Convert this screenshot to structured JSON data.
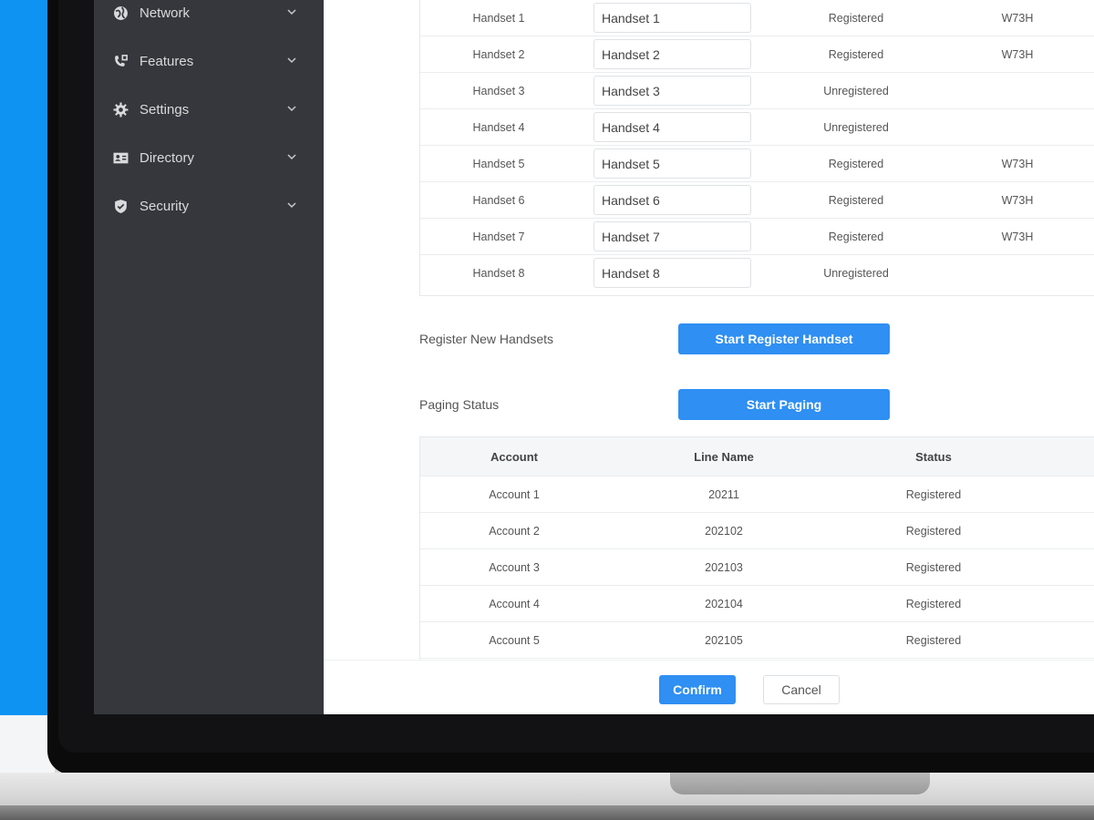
{
  "sidebar": {
    "items": [
      {
        "label": "Network",
        "icon": "globe-icon"
      },
      {
        "label": "Features",
        "icon": "phone-features-icon"
      },
      {
        "label": "Settings",
        "icon": "gear-icon"
      },
      {
        "label": "Directory",
        "icon": "contact-card-icon"
      },
      {
        "label": "Security",
        "icon": "shield-icon"
      }
    ]
  },
  "handsets": [
    {
      "index": "Handset 1",
      "name": "Handset 1",
      "status": "Registered",
      "model": "W73H"
    },
    {
      "index": "Handset 2",
      "name": "Handset 2",
      "status": "Registered",
      "model": "W73H"
    },
    {
      "index": "Handset 3",
      "name": "Handset 3",
      "status": "Unregistered",
      "model": ""
    },
    {
      "index": "Handset 4",
      "name": "Handset 4",
      "status": "Unregistered",
      "model": ""
    },
    {
      "index": "Handset 5",
      "name": "Handset 5",
      "status": "Registered",
      "model": "W73H"
    },
    {
      "index": "Handset 6",
      "name": "Handset 6",
      "status": "Registered",
      "model": "W73H"
    },
    {
      "index": "Handset 7",
      "name": "Handset 7",
      "status": "Registered",
      "model": "W73H"
    },
    {
      "index": "Handset 8",
      "name": "Handset 8",
      "status": "Unregistered",
      "model": ""
    }
  ],
  "register": {
    "label": "Register New Handsets",
    "button": "Start Register Handset"
  },
  "paging": {
    "label": "Paging Status",
    "button": "Start Paging"
  },
  "accounts": {
    "columns": [
      "Account",
      "Line Name",
      "Status"
    ],
    "rows": [
      {
        "account": "Account 1",
        "line": "20211",
        "status": "Registered"
      },
      {
        "account": "Account 2",
        "line": "202102",
        "status": "Registered"
      },
      {
        "account": "Account 3",
        "line": "202103",
        "status": "Registered"
      },
      {
        "account": "Account 4",
        "line": "202104",
        "status": "Registered"
      },
      {
        "account": "Account 5",
        "line": "202105",
        "status": "Registered"
      }
    ]
  },
  "footer": {
    "confirm": "Confirm",
    "cancel": "Cancel"
  },
  "colors": {
    "accent": "#2f8ff2",
    "sidebar": "#35373c",
    "backdrop": "#0f93f3"
  }
}
